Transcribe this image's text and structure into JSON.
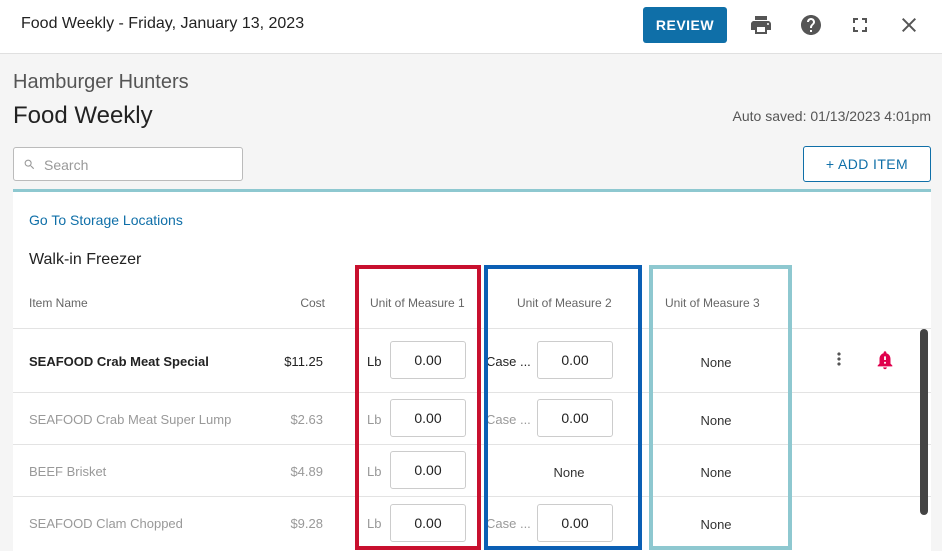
{
  "window": {
    "title": "Food Weekly - Friday, January 13, 2023"
  },
  "toolbar": {
    "review_label": "REVIEW"
  },
  "page": {
    "store_name": "Hamburger Hunters",
    "title": "Food Weekly",
    "auto_saved": "Auto saved: 01/13/2023 4:01pm"
  },
  "search": {
    "placeholder": "Search"
  },
  "add_item_label": "+ ADD ITEM",
  "goto_link": "Go To Storage Locations",
  "location": "Walk-in Freezer",
  "columns": {
    "item_name": "Item Name",
    "cost": "Cost",
    "uom1": "Unit of Measure 1",
    "uom2": "Unit of Measure 2",
    "uom3": "Unit of Measure 3"
  },
  "rows": [
    {
      "name": "SEAFOOD Crab Meat Special",
      "cost": "$11.25",
      "uom1_unit": "Lb",
      "uom1_qty": "0.00",
      "uom2_unit": "Case ...",
      "uom2_qty": "0.00",
      "uom3": "None"
    },
    {
      "name": "SEAFOOD Crab Meat Super Lump",
      "cost": "$2.63",
      "uom1_unit": "Lb",
      "uom1_qty": "0.00",
      "uom2_unit": "Case ...",
      "uom2_qty": "0.00",
      "uom3": "None"
    },
    {
      "name": "BEEF Brisket",
      "cost": "$4.89",
      "uom1_unit": "Lb",
      "uom1_qty": "0.00",
      "uom2_none": "None",
      "uom3": "None"
    },
    {
      "name": "SEAFOOD Clam Chopped",
      "cost": "$9.28",
      "uom1_unit": "Lb",
      "uom1_qty": "0.00",
      "uom2_unit": "Case ...",
      "uom2_qty": "0.00",
      "uom3": "None"
    }
  ],
  "colors": {
    "primary": "#0f6fa8",
    "highlight_uom1": "#c8102e",
    "highlight_uom2": "#0b5fb4",
    "highlight_uom3": "#8ec8d0",
    "alert": "#e0004d"
  }
}
